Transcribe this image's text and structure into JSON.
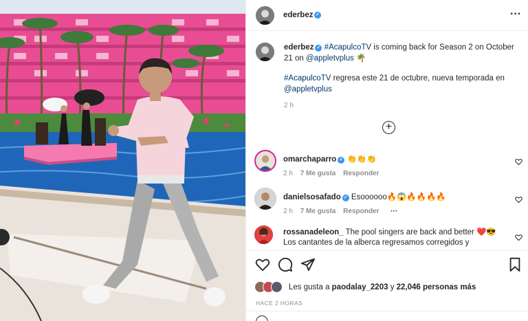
{
  "post": {
    "author": "ederbez",
    "menu_icon": "more-horizontal-icon",
    "caption_author": "ederbez",
    "caption_hashtag": "#AcapulcoTV",
    "caption_text_1": " is coming back for Season 2 on October 21 on ",
    "caption_mention": "@appletvplus",
    "caption_emoji": "🌴",
    "caption2_hashtag": "#AcapulcoTV",
    "caption2_text": " regresa este 21 de octubre, nueva temporada en ",
    "caption2_mention": "@appletvplus",
    "caption_time": "2 h"
  },
  "comments": [
    {
      "user": "omarchaparro",
      "verified": true,
      "text": "👏👏👏",
      "time": "2 h",
      "likes": "7 Me gusta",
      "reply": "Responder",
      "more": ""
    },
    {
      "user": "danielsosafado",
      "verified": true,
      "text": "Esoooooo🔥😱🔥🔥🔥🔥",
      "time": "2 h",
      "likes": "7 Me gusta",
      "reply": "Responder",
      "more": "···"
    },
    {
      "user": "rossanadeleon_",
      "verified": false,
      "text": "The pool singers are back and better ❤️😎 Los cantantes de la alberca regresamos corregidos y"
    }
  ],
  "actions": {
    "like_icon": "heart-icon",
    "comment_icon": "comment-icon",
    "share_icon": "send-icon",
    "save_icon": "bookmark-icon"
  },
  "likes": {
    "prefix": "Les gusta a ",
    "user": "paodalay_2203",
    "middle": " y ",
    "count": "22,046 personas más"
  },
  "time_ago": "HACE 2 HORAS",
  "colors": {
    "link": "#00376b",
    "verified": "#3897f0",
    "muted": "#8e8e8e",
    "hotel_pink": "#e84d93",
    "pool_blue": "#1f66b8"
  }
}
